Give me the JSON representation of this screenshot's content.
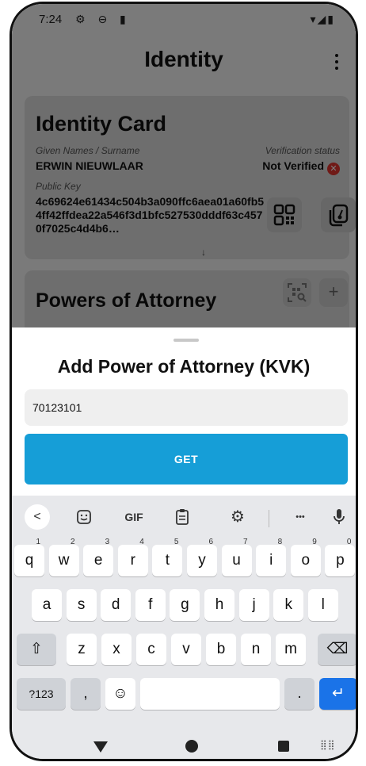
{
  "status_bar": {
    "time": "7:24",
    "left_icons": "⚙ ⊖ ▮",
    "right_icons": "▾◢▮"
  },
  "app_bar": {
    "title": "Identity"
  },
  "identity_card": {
    "title": "Identity Card",
    "names_label": "Given Names / Surname",
    "names_value": "ERWIN NIEUWLAAR",
    "verification_label": "Verification status",
    "verification_value": "Not Verified",
    "public_key_label": "Public Key",
    "public_key_value": "4c69624e61434c504b3a090ffc6aea01a60fb54ff42ffdea22a546f3d1bfc527530dddf63c4570f7025c4d4b6…",
    "expand_glyph": "↓"
  },
  "powers_card": {
    "title": "Powers of Attorney",
    "add_glyph": "+"
  },
  "sheet": {
    "title": "Add Power of Attorney (KVK)",
    "input_value": "70123101",
    "button_label": "GET"
  },
  "keyboard": {
    "toolbar": {
      "back": "<",
      "gif": "GIF",
      "more": "•••"
    },
    "row1": [
      {
        "k": "q",
        "s": "1"
      },
      {
        "k": "w",
        "s": "2"
      },
      {
        "k": "e",
        "s": "3"
      },
      {
        "k": "r",
        "s": "4"
      },
      {
        "k": "t",
        "s": "5"
      },
      {
        "k": "y",
        "s": "6"
      },
      {
        "k": "u",
        "s": "7"
      },
      {
        "k": "i",
        "s": "8"
      },
      {
        "k": "o",
        "s": "9"
      },
      {
        "k": "p",
        "s": "0"
      }
    ],
    "row2": [
      "a",
      "s",
      "d",
      "f",
      "g",
      "h",
      "j",
      "k",
      "l"
    ],
    "row3": [
      "z",
      "x",
      "c",
      "v",
      "b",
      "n",
      "m"
    ],
    "shift": "⇧",
    "backspace": "⌫",
    "symbols": "?123",
    "comma": ",",
    "emoji": "☺",
    "period": ".",
    "enter": "↵"
  }
}
